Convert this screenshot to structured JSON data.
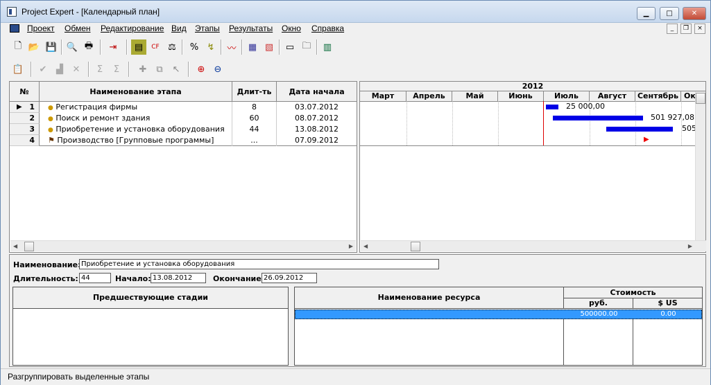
{
  "window": {
    "title": "Project Expert - [Календарный план]",
    "min": "▁",
    "max": "□",
    "close": "✕"
  },
  "menu": [
    "Проект",
    "Обмен",
    "Редактирование",
    "Вид",
    "Этапы",
    "Результаты",
    "Окно",
    "Справка"
  ],
  "mdi": {
    "min": "_",
    "restore": "❐",
    "close": "×"
  },
  "toolbar1": [
    "new-icon",
    "open-icon",
    "save-icon",
    "preview-icon",
    "print-icon",
    "exit-icon",
    "table-icon",
    "cashflow-icon",
    "balance-icon",
    "percent-icon",
    "sort-icon",
    "chart-icon",
    "report-icon",
    "report2-icon",
    "card-icon",
    "folder-icon",
    "calendar-icon"
  ],
  "toolbar2": [
    "form-icon",
    "check-icon",
    "bars-icon",
    "delete-icon",
    "sum-icon",
    "unsum-icon",
    "group-icon",
    "ungroup-icon",
    "pointer-icon",
    "zoom-in-icon",
    "zoom-out-icon"
  ],
  "grid": {
    "headers": {
      "num": "№",
      "name": "Наименование этапа",
      "dur": "Длит-ть",
      "start": "Дата начала"
    },
    "rows": [
      {
        "num": "1",
        "name": "Регистрация фирмы",
        "dur": "8",
        "start": "03.07.2012",
        "icon": "bullet-icon",
        "selected": true
      },
      {
        "num": "2",
        "name": "Поиск и ремонт здания",
        "dur": "60",
        "start": "08.07.2012",
        "icon": "bullet-icon"
      },
      {
        "num": "3",
        "name": "Приобретение и установка оборудования",
        "dur": "44",
        "start": "13.08.2012",
        "icon": "bullet-icon"
      },
      {
        "num": "4",
        "name": "Производство [Групповые программы]",
        "dur": "...",
        "start": "07.09.2012",
        "icon": "group-icon"
      }
    ]
  },
  "gantt": {
    "year": "2012",
    "months": [
      "Март",
      "Апрель",
      "Май",
      "Июнь",
      "Июль",
      "Август",
      "Сентябрь",
      "Ок"
    ],
    "labels": [
      "25  000,00",
      "501  927,08",
      "505"
    ]
  },
  "details": {
    "name_label": "Наименование:",
    "name_value": "Приобретение и установка оборудования",
    "duration_label": "Длительность:",
    "duration_value": "44",
    "start_label": "Начало:",
    "start_value": "13.08.2012",
    "end_label": "Окончание:",
    "end_value": "26.09.2012"
  },
  "predecessors": {
    "header": "Предшествующие стадии"
  },
  "resources": {
    "header": "Наименование ресурса",
    "cost_header": "Стоимость",
    "rub_header": "руб.",
    "usd_header": "$ US",
    "rows": [
      {
        "name": "",
        "rub": "500000.00",
        "usd": "0.00"
      }
    ]
  },
  "status": "Разгруппировать выделенные этапы"
}
